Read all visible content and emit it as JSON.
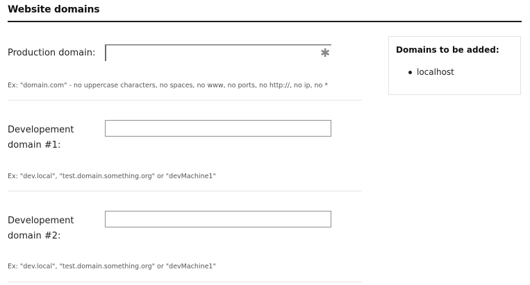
{
  "section": {
    "title": "Website domains"
  },
  "fields": [
    {
      "label": "Production domain:",
      "value": "",
      "required_mark": "✱",
      "hint": "Ex: \"domain.com\" - no uppercase characters, no spaces, no www, no ports, no http://, no ip, no *"
    },
    {
      "label_line1": "Developement",
      "label_line2": "domain #1:",
      "value": "",
      "hint": "Ex: \"dev.local\", \"test.domain.something.org\" or \"devMachine1\""
    },
    {
      "label_line1": "Developement",
      "label_line2": "domain #2:",
      "value": "",
      "hint": "Ex: \"dev.local\", \"test.domain.something.org\" or \"devMachine1\""
    }
  ],
  "sidebar": {
    "title": "Domains to be added:",
    "items": [
      "localhost"
    ]
  }
}
